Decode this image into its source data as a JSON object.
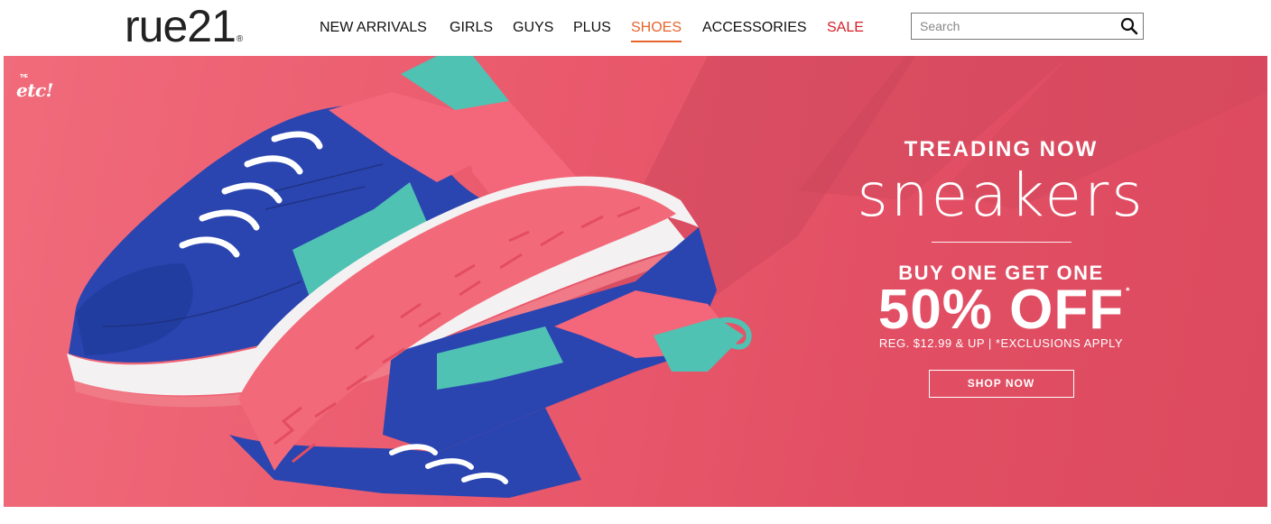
{
  "header": {
    "logo_text": "rue21",
    "logo_mark": "®",
    "nav": [
      {
        "label": "NEW ARRIVALS"
      },
      {
        "label": "GIRLS"
      },
      {
        "label": "GUYS"
      },
      {
        "label": "PLUS"
      },
      {
        "label": "SHOES"
      },
      {
        "label": "ACCESSORIES"
      },
      {
        "label": "SALE"
      }
    ],
    "active_nav": "SHOES",
    "search": {
      "placeholder": "Search",
      "icon": "search-icon"
    }
  },
  "hero": {
    "sub_brand": {
      "the": "THE",
      "name": "etc!"
    },
    "kicker": "TREADING NOW",
    "headline": "sneakers",
    "offer_line1": "BUY ONE GET ONE",
    "offer_line2": "50% OFF",
    "offer_mark": "*",
    "fine_print": "REG. $12.99 & UP | *EXCLUSIONS APPLY",
    "cta": "SHOP NOW"
  },
  "colors": {
    "accent_active": "#e8642d",
    "sale": "#d61f26",
    "hero_bg": "#e85a6c",
    "shoe_blue": "#2340a8",
    "shoe_pink": "#f4667a",
    "shoe_teal": "#4fc2b3"
  }
}
